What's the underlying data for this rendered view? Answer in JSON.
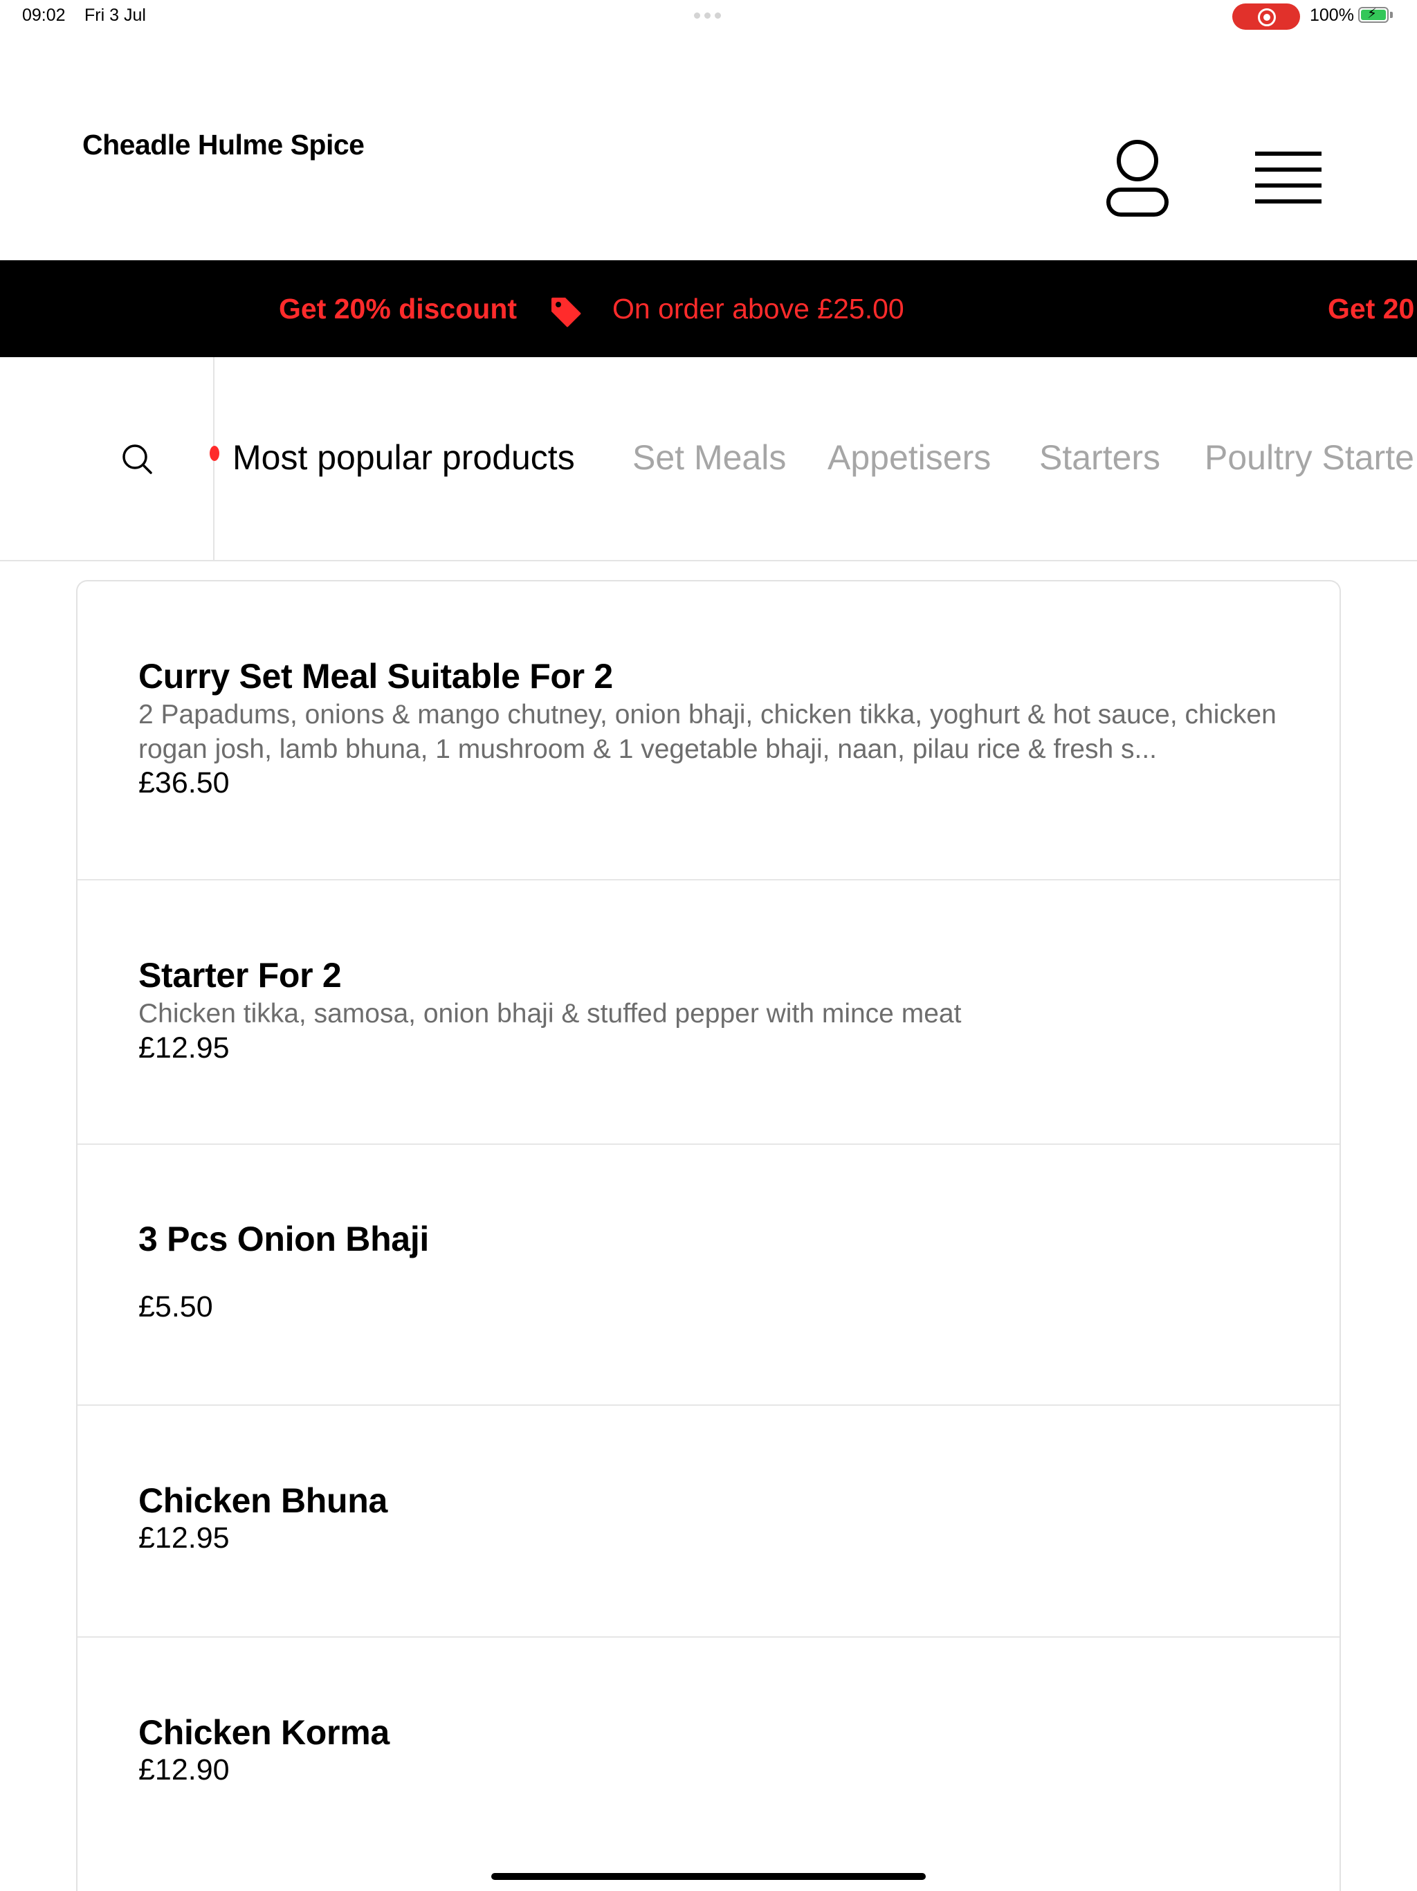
{
  "status_bar": {
    "time": "09:02",
    "date": "Fri 3 Jul",
    "battery": "100%"
  },
  "header": {
    "restaurant_name": "Cheadle Hulme Spice",
    "account_icon": "user-icon",
    "menu_icon": "hamburger-menu-icon"
  },
  "promo": {
    "headline": "Get 20% discount",
    "condition": "On order above £25.00",
    "headline_repeat": "Get 20",
    "icon": "price-tag-icon"
  },
  "categories": {
    "search_icon": "search-icon",
    "tabs": [
      {
        "label": "Most popular products",
        "active": true
      },
      {
        "label": "Set Meals",
        "active": false
      },
      {
        "label": "Appetisers",
        "active": false
      },
      {
        "label": "Starters",
        "active": false
      },
      {
        "label": "Poultry Starte",
        "active": false
      }
    ]
  },
  "products": [
    {
      "name": "Curry Set Meal Suitable For 2",
      "description": "2 Papadums, onions & mango chutney, onion bhaji, chicken tikka, yoghurt & hot sauce, chicken rogan josh, lamb bhuna, 1 mushroom & 1 vegetable bhaji, naan, pilau rice & fresh s...",
      "price": "£36.50"
    },
    {
      "name": "Starter For 2",
      "description": "Chicken tikka, samosa, onion bhaji & stuffed pepper with mince meat",
      "price": "£12.95"
    },
    {
      "name": "3 Pcs Onion Bhaji",
      "description": "",
      "price": "£5.50"
    },
    {
      "name": "Chicken Bhuna",
      "description": "",
      "price": "£12.95"
    },
    {
      "name": "Chicken Korma",
      "description": "",
      "price": "£12.90"
    }
  ],
  "colors": {
    "accent_red": "#ff2b2b",
    "promo_background": "#000000",
    "inactive_tab": "#a6a6a6",
    "description_text": "#6d6d6d",
    "battery_green": "#34c759",
    "record_indicator": "#e1312b"
  }
}
